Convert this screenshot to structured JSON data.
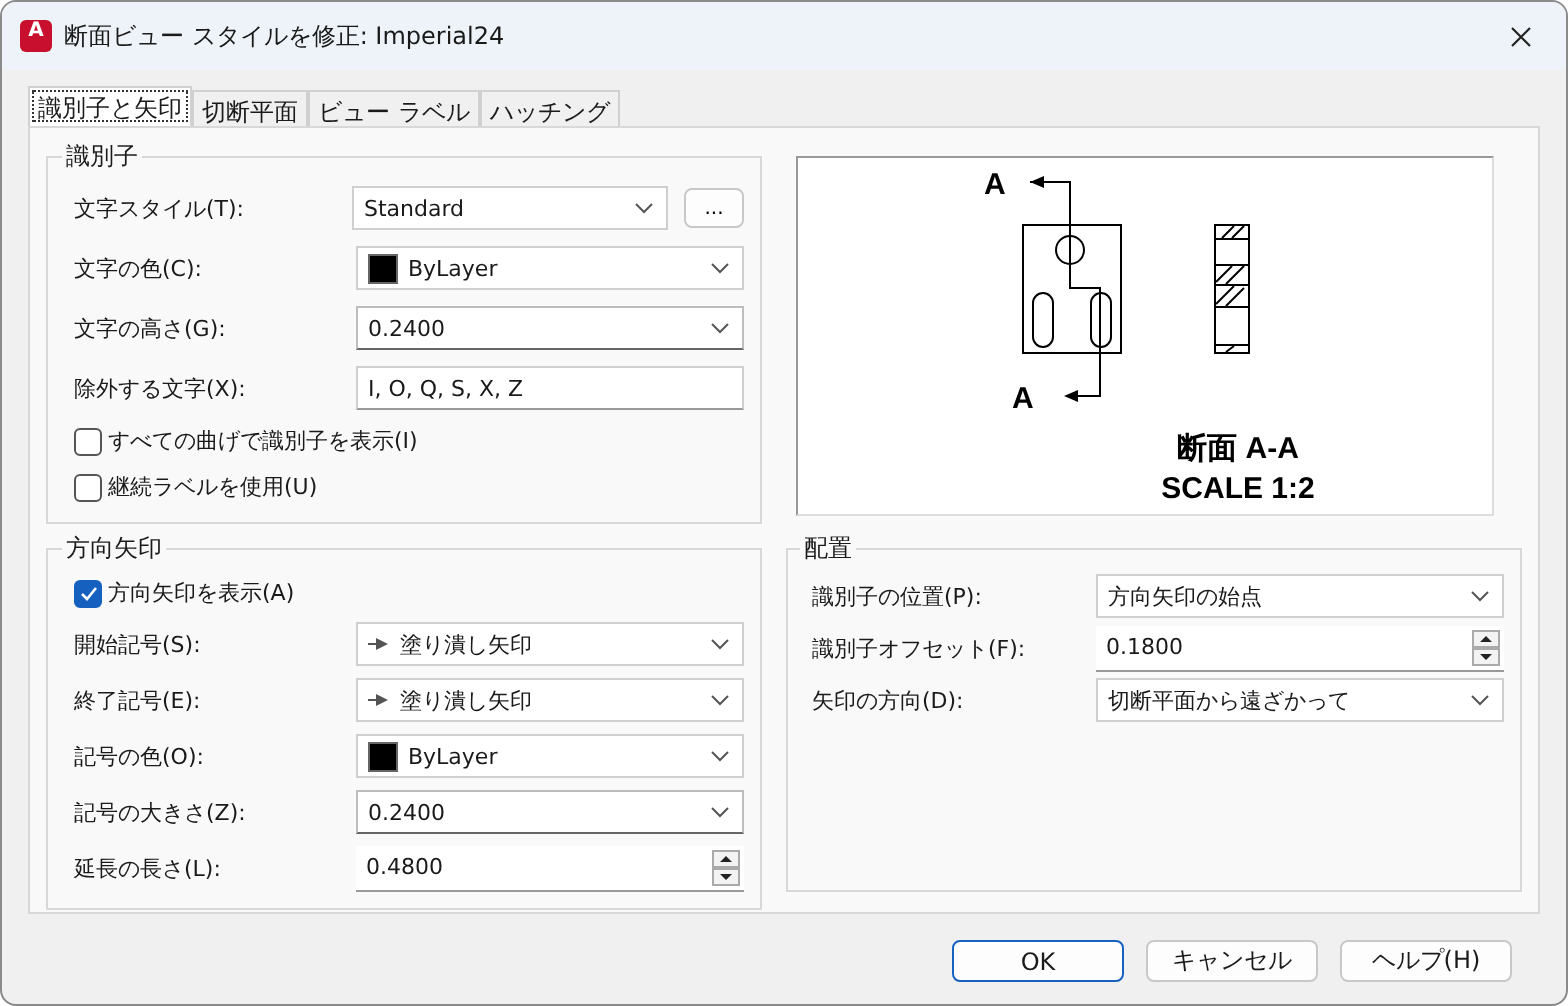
{
  "window": {
    "icon_text": "A",
    "title": "断面ビュー スタイルを修正: Imperial24"
  },
  "tabs": [
    {
      "label": "識別子と矢印",
      "selected": true
    },
    {
      "label": "切断平面",
      "selected": false
    },
    {
      "label": "ビュー ラベル",
      "selected": false
    },
    {
      "label": "ハッチング",
      "selected": false
    }
  ],
  "identifier_group": {
    "title": "識別子",
    "rows": [
      {
        "kind": "combo",
        "label": "文字スタイル(T):",
        "value": "Standard",
        "button": "..."
      },
      {
        "kind": "color_combo",
        "label": "文字の色(C):",
        "value": "ByLayer",
        "color": "#000000"
      },
      {
        "kind": "edit_combo",
        "label": "文字の高さ(G):",
        "value": "0.2400"
      },
      {
        "kind": "text",
        "label": "除外する文字(X):",
        "value": "I, O, Q, S, X, Z"
      }
    ],
    "checkboxes": [
      {
        "label": "すべての曲げで識別子を表示(I)",
        "checked": false
      },
      {
        "label": "継続ラベルを使用(U)",
        "checked": false
      }
    ]
  },
  "arrow_group": {
    "title": "方向矢印",
    "checkbox": {
      "label": "方向矢印を表示(A)",
      "checked": true
    },
    "rows": [
      {
        "kind": "arrow_combo",
        "label": "開始記号(S):",
        "value": "塗り潰し矢印"
      },
      {
        "kind": "arrow_combo",
        "label": "終了記号(E):",
        "value": "塗り潰し矢印"
      },
      {
        "kind": "color_combo",
        "label": "記号の色(O):",
        "value": "ByLayer",
        "color": "#000000"
      },
      {
        "kind": "edit_combo",
        "label": "記号の大きさ(Z):",
        "value": "0.2400"
      },
      {
        "kind": "spin",
        "label": "延長の長さ(L):",
        "value": "0.4800"
      }
    ]
  },
  "preview": {
    "top_label": "A",
    "bottom_label": "A",
    "caption_title": "断面 A-A",
    "caption_scale": "SCALE 1:2"
  },
  "placement_group": {
    "title": "配置",
    "rows": [
      {
        "kind": "combo",
        "label": "識別子の位置(P):",
        "value": "方向矢印の始点"
      },
      {
        "kind": "spin",
        "label": "識別子オフセット(F):",
        "value": "0.1800"
      },
      {
        "kind": "combo",
        "label": "矢印の方向(D):",
        "value": "切断平面から遠ざかって"
      }
    ]
  },
  "buttons": [
    {
      "label": "OK",
      "default": true
    },
    {
      "label": "キャンセル",
      "default": false
    },
    {
      "label": "ヘルプ(H)",
      "default": false
    }
  ]
}
